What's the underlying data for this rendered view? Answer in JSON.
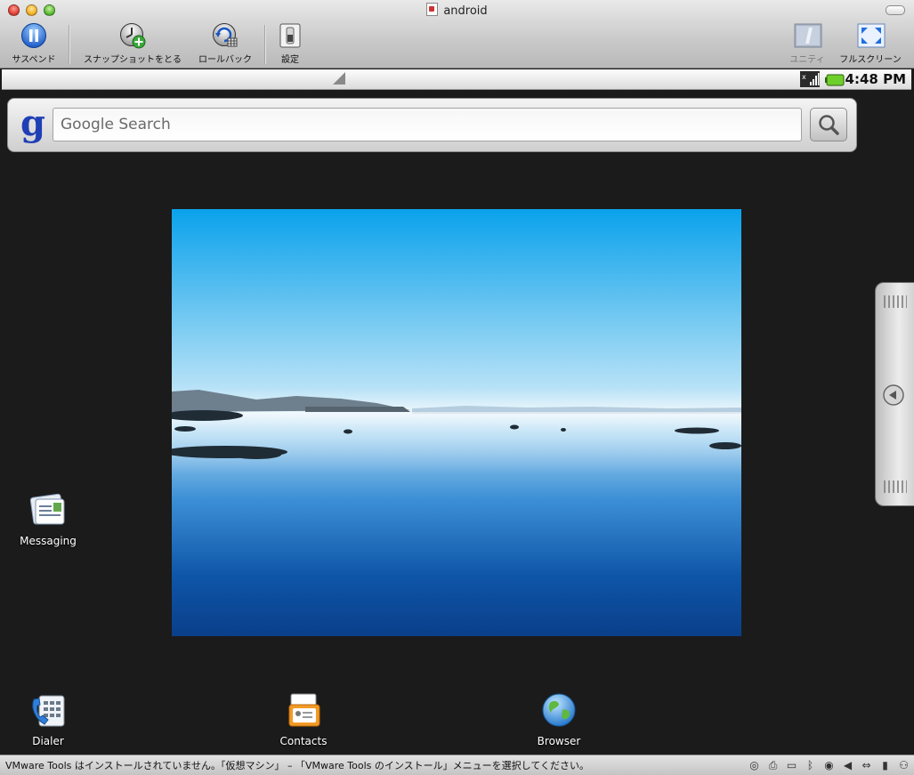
{
  "window": {
    "title": "android"
  },
  "toolbar": {
    "suspend_label": "サスペンド",
    "snapshot_label": "スナップショットをとる",
    "rollback_label": "ロールバック",
    "settings_label": "設定",
    "unity_label": "ユニティ",
    "fullscreen_label": "フルスクリーン"
  },
  "android": {
    "status_time": "4:48 PM",
    "search": {
      "placeholder": "Google Search"
    },
    "apps": {
      "messaging": "Messaging",
      "dialer": "Dialer",
      "contacts": "Contacts",
      "browser": "Browser"
    }
  },
  "statusbar": {
    "message": "VMware Tools はインストールされていません。「仮想マシン」 – 「VMware Tools のインストール」メニューを選択してください。"
  },
  "colors": {
    "google_blue": "#1f3fb5",
    "battery_green": "#6fcf2a"
  },
  "icons": [
    "pause-icon",
    "snapshot-icon",
    "rollback-icon",
    "settings-icon",
    "unity-icon",
    "fullscreen-icon",
    "signal-icon",
    "battery-icon",
    "search-icon",
    "drawer-arrow-icon",
    "messaging-icon",
    "dialer-icon",
    "contacts-icon",
    "browser-icon"
  ]
}
